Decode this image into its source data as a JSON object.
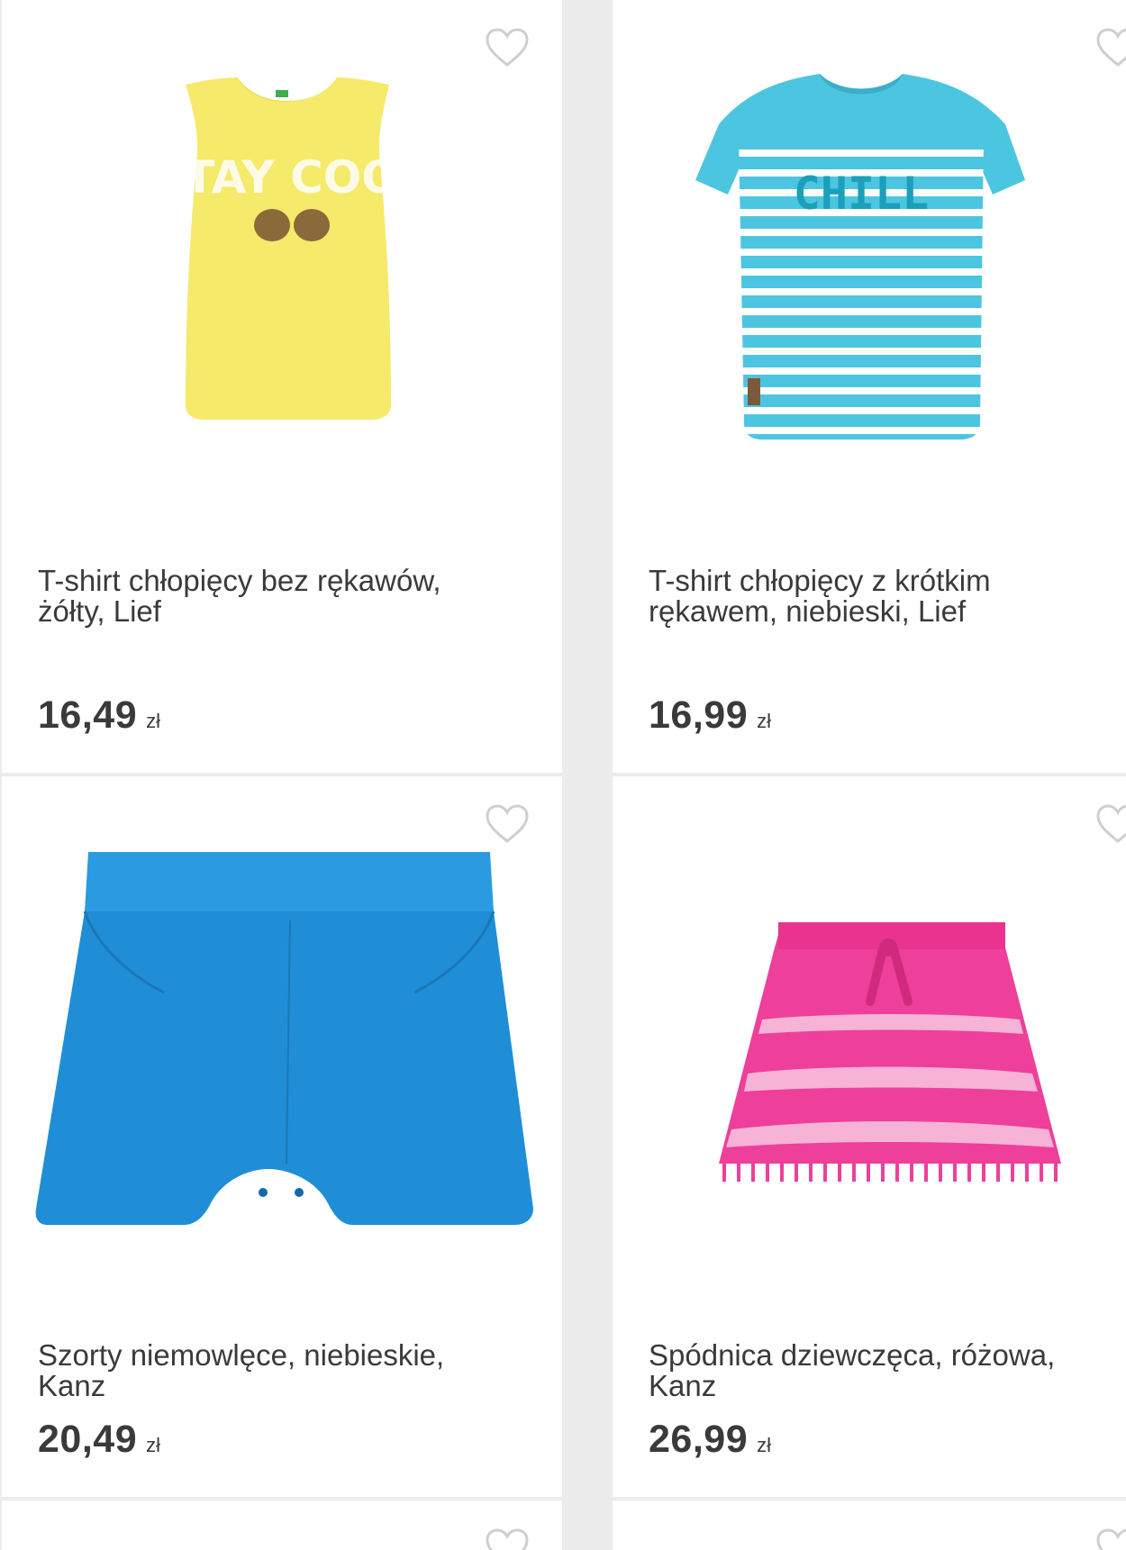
{
  "products": [
    {
      "name": "T-shirt chłopięcy bez rękawów, żółty, Lief",
      "price": "16,49",
      "currency": "zł",
      "image": "yellow-tank-top",
      "image_text": "STAY COOL",
      "color": "#f5ea6a"
    },
    {
      "name": "T-shirt chłopięcy z krótkim rękawem, niebieski, Lief",
      "price": "16,99",
      "currency": "zł",
      "image": "blue-striped-tshirt",
      "image_text": "CHILL",
      "color": "#4cc6e0"
    },
    {
      "name": "Szorty niemowlęce, niebieskie, Kanz",
      "price": "20,49",
      "currency": "zł",
      "image": "blue-shorts",
      "color": "#1f8ed6"
    },
    {
      "name": "Spódnica dziewczęca, różowa, Kanz",
      "price": "26,99",
      "currency": "zł",
      "image": "pink-skirt",
      "color": "#ee3f9a"
    }
  ],
  "favorite_icon": "heart-outline-icon"
}
